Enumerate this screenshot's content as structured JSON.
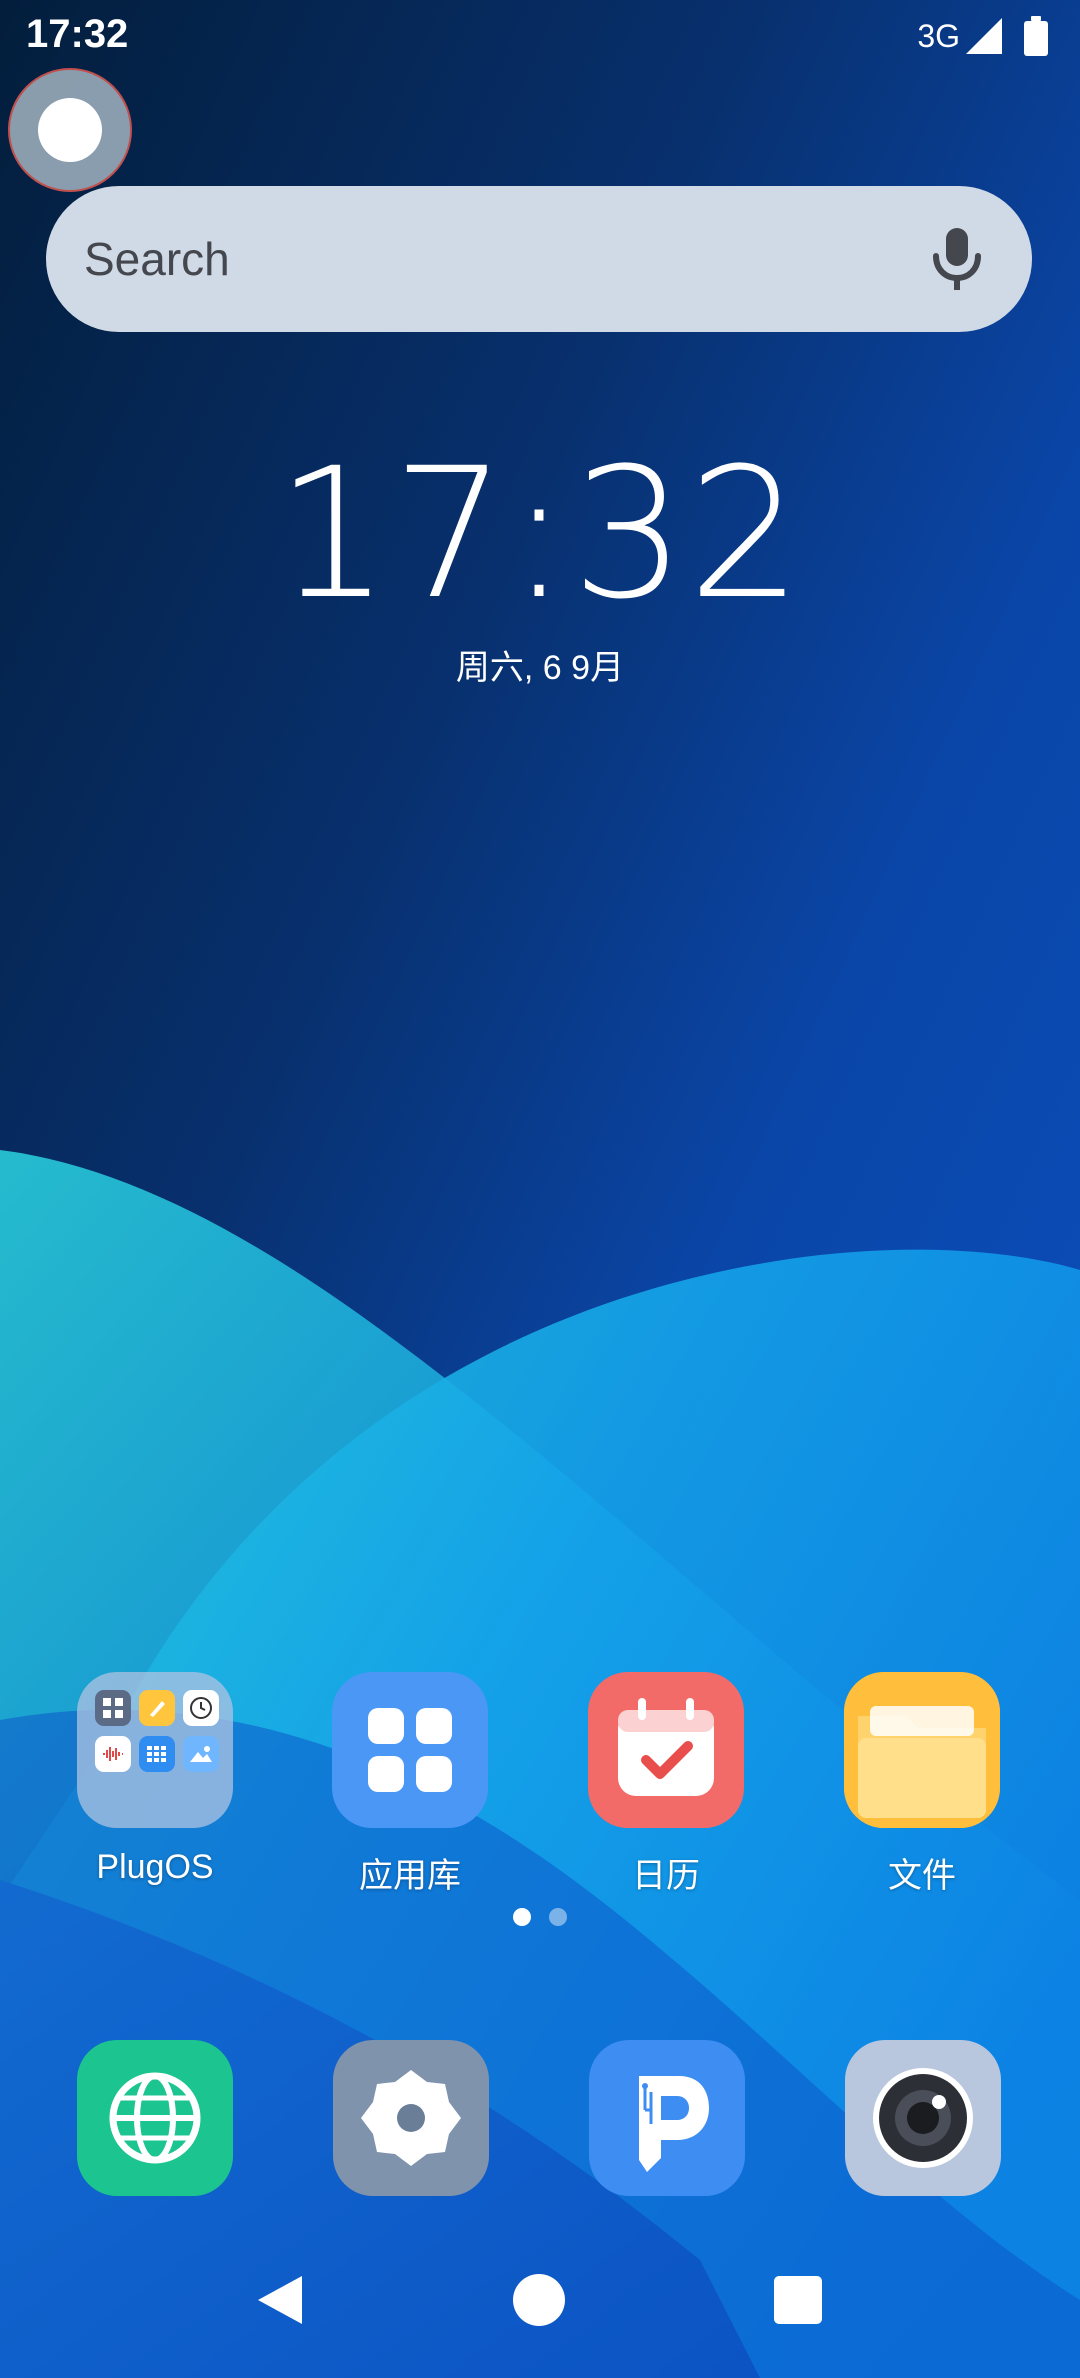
{
  "status_bar": {
    "time": "17:32",
    "network": "3G",
    "icons": [
      "signal-icon",
      "battery-icon"
    ]
  },
  "assistive_touch": {
    "icon": "assistive-touch-icon"
  },
  "search": {
    "placeholder": "Search",
    "mic_icon": "microphone-icon"
  },
  "clock_widget": {
    "time": "17:32",
    "date": "周六, 6 9月"
  },
  "home_apps": [
    {
      "label": "PlugOS",
      "icon": "folder-icon"
    },
    {
      "label": "应用库",
      "icon": "app-library-icon"
    },
    {
      "label": "日历",
      "icon": "calendar-icon"
    },
    {
      "label": "文件",
      "icon": "files-icon"
    }
  ],
  "page_indicator": {
    "total": 2,
    "current": 1
  },
  "dock": [
    {
      "icon": "browser-icon"
    },
    {
      "icon": "settings-icon"
    },
    {
      "icon": "plug-app-icon"
    },
    {
      "icon": "camera-icon"
    }
  ],
  "nav_bar": [
    "back-icon",
    "home-icon",
    "recents-icon"
  ],
  "colors": {
    "wallpaper_dark": "#07265a",
    "wallpaper_blue": "#0a4fb8",
    "wave_teal": "#23c4d8",
    "wave_sky": "#1aa6ee",
    "search_bg": "#d0d9e6",
    "calendar_red": "#f36b68",
    "files_yellow": "#ffc53d",
    "browser_green": "#1cc58f",
    "app_blue": "#4a97f5"
  }
}
